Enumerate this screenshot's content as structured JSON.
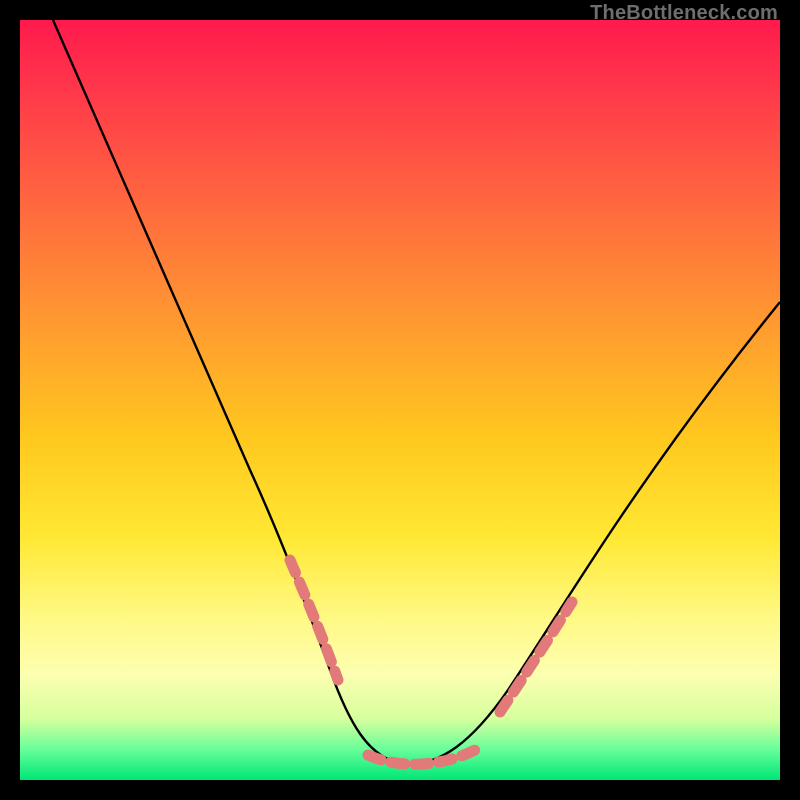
{
  "watermark": "TheBottleneck.com",
  "chart_data": {
    "type": "line",
    "title": "",
    "xlabel": "",
    "ylabel": "",
    "xlim": [
      0,
      100
    ],
    "ylim": [
      0,
      100
    ],
    "note": "No axis ticks or numeric labels are rendered; values are estimated from geometry. y=0 is the bottom (green) edge. The black curve is a V-shaped bottleneck curve with its minimum near x≈50.",
    "series": [
      {
        "name": "bottleneck-curve",
        "x": [
          5,
          10,
          15,
          20,
          25,
          30,
          35,
          38,
          41,
          44,
          47,
          50,
          53,
          56,
          61,
          66,
          72,
          78,
          85,
          92,
          100
        ],
        "y": [
          100,
          88,
          76,
          64,
          52,
          40,
          28,
          20,
          13,
          8,
          4,
          2,
          2,
          3,
          6,
          11,
          18,
          27,
          38,
          50,
          63
        ]
      },
      {
        "name": "highlight-dots-left",
        "x": [
          35.0,
          35.7,
          36.5,
          37.3,
          38.2,
          39.2,
          40.3
        ],
        "y": [
          27.0,
          24.5,
          22.0,
          19.5,
          17.0,
          14.5,
          12.0
        ]
      },
      {
        "name": "highlight-dots-bottom",
        "x": [
          45,
          47,
          49,
          51,
          53,
          55,
          57,
          59
        ],
        "y": [
          3.0,
          2.3,
          2.0,
          2.0,
          2.1,
          2.5,
          3.1,
          4.0
        ]
      },
      {
        "name": "highlight-dots-right",
        "x": [
          62.5,
          63.8,
          65.1,
          66.4,
          67.7,
          69.0,
          70.3,
          71.6
        ],
        "y": [
          8.0,
          9.6,
          11.3,
          13.0,
          14.7,
          16.5,
          18.3,
          20.0
        ]
      }
    ],
    "colors": {
      "curve": "#000000",
      "dots": "#e27a7a"
    }
  }
}
